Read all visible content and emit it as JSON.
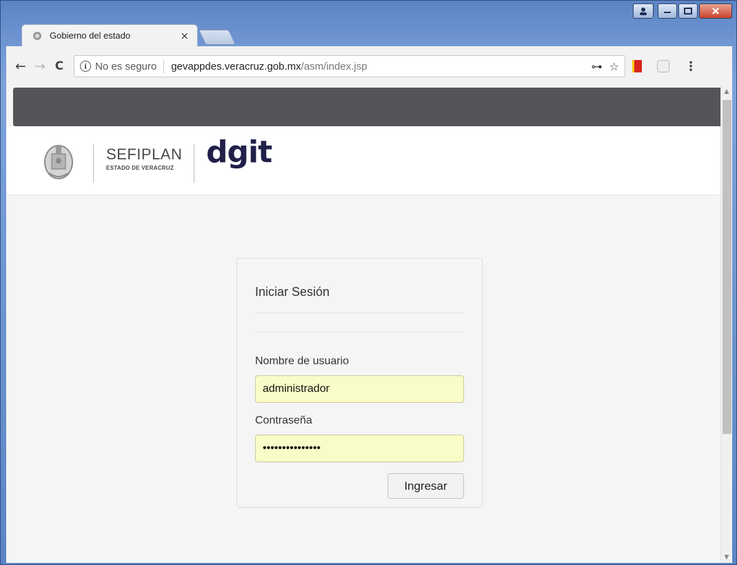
{
  "window": {
    "controls": [
      "profile",
      "minimize",
      "maximize",
      "close"
    ]
  },
  "tab": {
    "title": "Gobierno del estado",
    "close_glyph": "×",
    "favicon": "seal-icon"
  },
  "toolbar": {
    "back_glyph": "←",
    "forward_glyph": "→",
    "reload_glyph": "C",
    "security_label": "No es seguro",
    "url_host": "gevappdes.veracruz.gob.mx",
    "url_path": "/asm/index.jsp",
    "key_glyph": "⊶",
    "star_glyph": "☆",
    "menu_glyph": "⋮"
  },
  "header": {
    "org_name": "SEFIPLAN",
    "org_sub": "ESTADO DE VERACRUZ",
    "brand": "dgit"
  },
  "login": {
    "title": "Iniciar Sesión",
    "username_label": "Nombre de usuario",
    "username_value": "administrador",
    "password_label": "Contraseña",
    "password_value": "•••••••••••••••",
    "submit_label": "Ingresar"
  },
  "colors": {
    "topbar": "#555458",
    "autofill": "#fafcc7",
    "brand": "#20204a"
  }
}
